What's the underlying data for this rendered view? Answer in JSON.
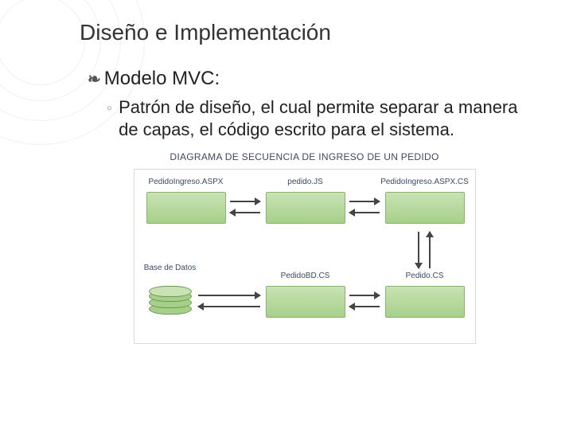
{
  "title": "Diseño e Implementación",
  "bullet": "Modelo MVC:",
  "sub": "Patrón de diseño, el cual permite separar a manera de capas, el código escrito para el sistema.",
  "diagram": {
    "heading": "DIAGRAMA DE SECUENCIA DE INGRESO DE UN PEDIDO",
    "labels": {
      "n1": "PedidoIngreso.ASPX",
      "n2": "pedido.JS",
      "n3": "PedidoIngreso.ASPX.CS",
      "n4": "Base de Datos",
      "n5": "PedidoBD.CS",
      "n6": "Pedido.CS"
    }
  }
}
